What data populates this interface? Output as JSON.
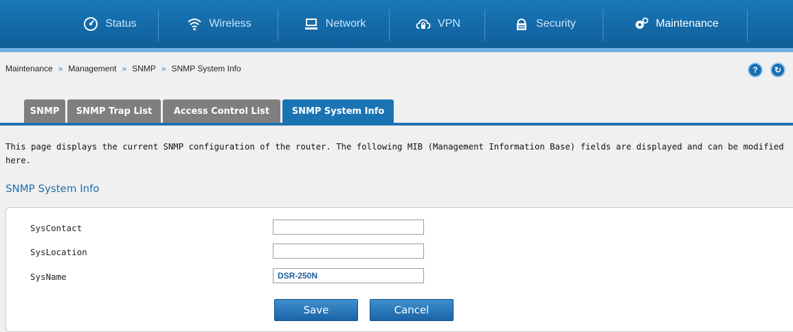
{
  "nav": {
    "items": [
      {
        "label": "Status",
        "icon": "gauge-icon"
      },
      {
        "label": "Wireless",
        "icon": "wifi-icon"
      },
      {
        "label": "Network",
        "icon": "monitor-icon"
      },
      {
        "label": "VPN",
        "icon": "cloud-lock-icon"
      },
      {
        "label": "Security",
        "icon": "lock-icon"
      },
      {
        "label": "Maintenance",
        "icon": "gears-icon"
      }
    ],
    "active": "Maintenance"
  },
  "breadcrumb": [
    "Maintenance",
    "Management",
    "SNMP",
    "SNMP System Info"
  ],
  "breadcrumb_sep": "»",
  "header_buttons": {
    "help": "?",
    "refresh": "↻"
  },
  "tabs": [
    "SNMP",
    "SNMP Trap List",
    "Access Control List",
    "SNMP System Info"
  ],
  "active_tab": "SNMP System Info",
  "description": "This page displays the current SNMP configuration of the router. The following MIB (Management Information Base) fields are displayed and can be modified here.",
  "section_title": "SNMP System Info",
  "form": {
    "fields": [
      {
        "label": "SysContact",
        "value": ""
      },
      {
        "label": "SysLocation",
        "value": ""
      },
      {
        "label": "SysName",
        "value": "DSR-250N"
      }
    ],
    "save_label": "Save",
    "cancel_label": "Cancel"
  },
  "colors": {
    "nav_bg": "#1a78b8",
    "accent": "#1b73b4",
    "tab_inactive": "#7f7f7f"
  }
}
